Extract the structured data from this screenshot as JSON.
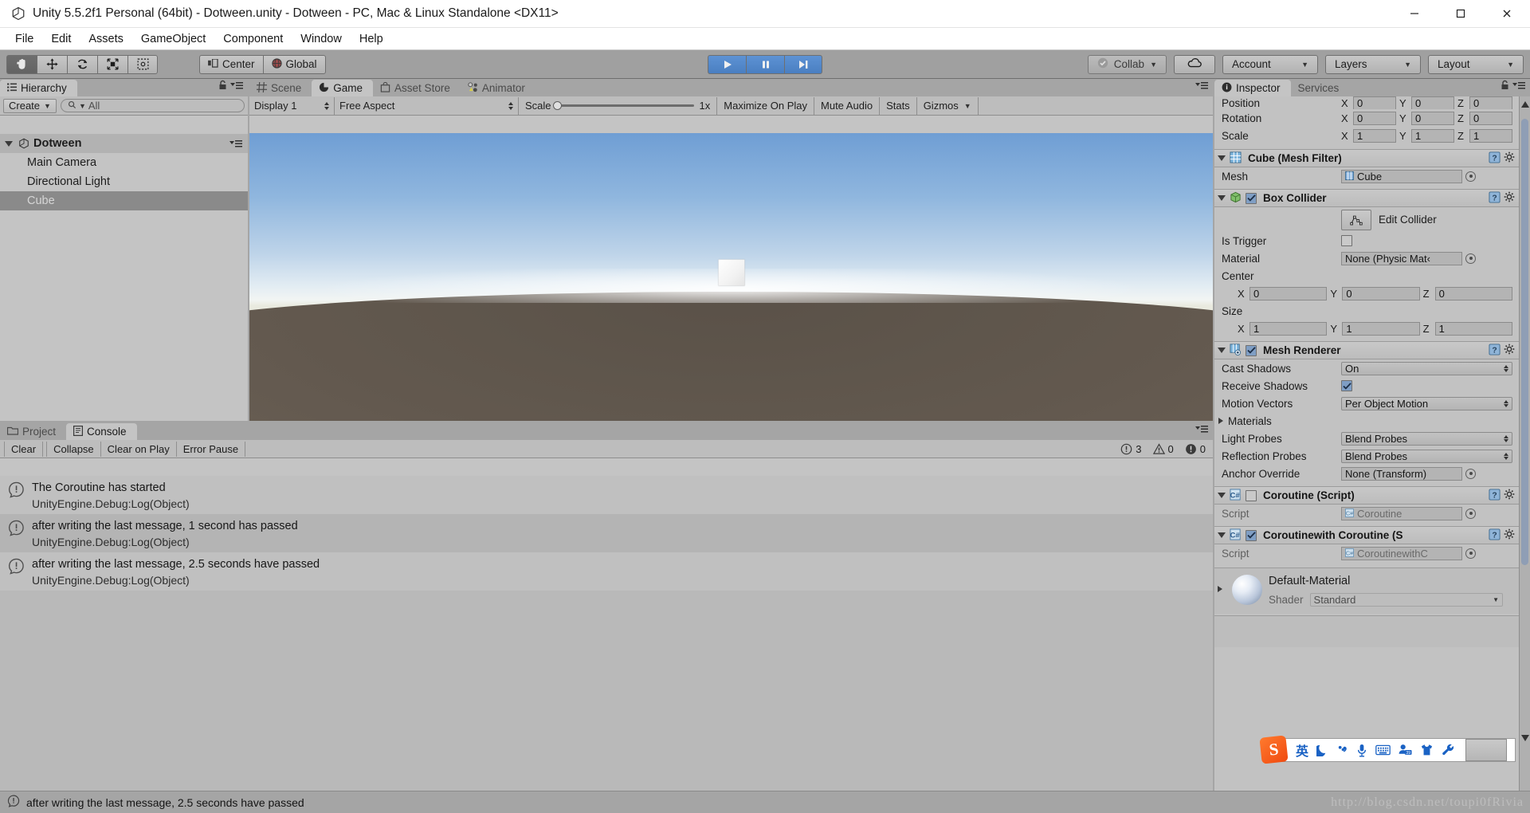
{
  "window": {
    "title": "Unity 5.5.2f1 Personal (64bit) - Dotween.unity - Dotween - PC, Mac & Linux Standalone <DX11>",
    "minimize": "—",
    "maximize": "❐",
    "close": "✕"
  },
  "menubar": {
    "items": [
      "File",
      "Edit",
      "Assets",
      "GameObject",
      "Component",
      "Window",
      "Help"
    ]
  },
  "toolbar": {
    "tools": [
      {
        "name": "hand-tool",
        "active": true
      },
      {
        "name": "move-tool",
        "active": false
      },
      {
        "name": "rotate-tool",
        "active": false
      },
      {
        "name": "scale-tool",
        "active": false
      },
      {
        "name": "rect-tool",
        "active": false
      }
    ],
    "pivot_label": "Center",
    "space_label": "Global",
    "play_label": "▶",
    "pause_label": "▐▌",
    "step_label": "▶|",
    "collab_label": "Collab",
    "cloud_label": "cloud-icon",
    "account_label": "Account",
    "layers_label": "Layers",
    "layout_label": "Layout"
  },
  "hierarchy": {
    "tab_label": "Hierarchy",
    "create_label": "Create",
    "search_placeholder": "All",
    "scene_name": "Dotween",
    "objects": [
      {
        "label": "Main Camera",
        "selected": false
      },
      {
        "label": "Directional Light",
        "selected": false
      },
      {
        "label": "Cube",
        "selected": true
      }
    ]
  },
  "gameview": {
    "tabs": [
      {
        "label": "Scene",
        "active": false,
        "icon": "grid-icon"
      },
      {
        "label": "Game",
        "active": true,
        "icon": "gamepad-icon"
      },
      {
        "label": "Asset Store",
        "active": false,
        "icon": "store-icon"
      },
      {
        "label": "Animator",
        "active": false,
        "icon": "animator-icon"
      }
    ],
    "display": "Display 1",
    "aspect": "Free Aspect",
    "scale_label": "Scale",
    "scale_value": "1x",
    "maximize_on_play": "Maximize On Play",
    "mute_audio": "Mute Audio",
    "stats": "Stats",
    "gizmos": "Gizmos"
  },
  "console": {
    "tabs": [
      {
        "label": "Project",
        "active": false,
        "icon": "folder-icon"
      },
      {
        "label": "Console",
        "active": true,
        "icon": "console-icon"
      }
    ],
    "buttons": [
      "Clear",
      "Collapse",
      "Clear on Play",
      "Error Pause"
    ],
    "counts": {
      "info": "3",
      "warning": "0",
      "error": "0"
    },
    "logs": [
      {
        "message": "The Coroutine has started",
        "stack": "UnityEngine.Debug:Log(Object)"
      },
      {
        "message": "after writing the last message, 1 second has passed",
        "stack": "UnityEngine.Debug:Log(Object)"
      },
      {
        "message": "after writing the last message, 2.5 seconds have passed",
        "stack": "UnityEngine.Debug:Log(Object)"
      }
    ]
  },
  "inspector": {
    "tabs": [
      {
        "label": "Inspector",
        "active": true
      },
      {
        "label": "Services",
        "active": false
      }
    ],
    "transform": {
      "position": {
        "label": "Position",
        "x": "0",
        "y": "0",
        "z": "0"
      },
      "rotation": {
        "label": "Rotation",
        "x": "0",
        "y": "0",
        "z": "0"
      },
      "scale": {
        "label": "Scale",
        "x": "1",
        "y": "1",
        "z": "1"
      }
    },
    "mesh_filter": {
      "title": "Cube (Mesh Filter)",
      "mesh_label": "Mesh",
      "mesh_value": "Cube"
    },
    "box_collider": {
      "title": "Box Collider",
      "enabled": true,
      "edit_collider": "Edit Collider",
      "is_trigger_label": "Is Trigger",
      "is_trigger": false,
      "material_label": "Material",
      "material_value": "None (Physic Mat‹",
      "center_label": "Center",
      "center": {
        "x": "0",
        "y": "0",
        "z": "0"
      },
      "size_label": "Size",
      "size": {
        "x": "1",
        "y": "1",
        "z": "1"
      }
    },
    "mesh_renderer": {
      "title": "Mesh Renderer",
      "enabled": true,
      "cast_shadows_label": "Cast Shadows",
      "cast_shadows_value": "On",
      "receive_shadows_label": "Receive Shadows",
      "receive_shadows": true,
      "motion_vectors_label": "Motion Vectors",
      "motion_vectors_value": "Per Object Motion",
      "materials_label": "Materials",
      "light_probes_label": "Light Probes",
      "light_probes_value": "Blend Probes",
      "reflection_probes_label": "Reflection Probes",
      "reflection_probes_value": "Blend Probes",
      "anchor_override_label": "Anchor Override",
      "anchor_override_value": "None (Transform)"
    },
    "script_1": {
      "title": "Coroutine (Script)",
      "enabled": false,
      "script_label": "Script",
      "script_value": "Coroutine"
    },
    "script_2": {
      "title": "Coroutinewith Coroutine (S",
      "enabled": true,
      "script_label": "Script",
      "script_value": "CoroutinewithC"
    },
    "material": {
      "title": "Default-Material",
      "shader_label": "Shader",
      "shader_value": "Standard"
    }
  },
  "ime": {
    "logo": "S",
    "items": [
      "英",
      "moon-icon",
      "comma-icon",
      "mic-icon",
      "keyboard-icon",
      "emoji-icon",
      "skin-icon",
      "wrench-icon"
    ]
  },
  "statusbar": {
    "message": "after writing the last message, 2.5 seconds have passed"
  },
  "watermark": {
    "text": "http://blog.csdn.net/toupi0fRivia"
  },
  "colors": {
    "accent_blue": "#4a7fc1",
    "panel_bg": "#c4c4c4",
    "chrome_bg": "#a5a5a5"
  }
}
